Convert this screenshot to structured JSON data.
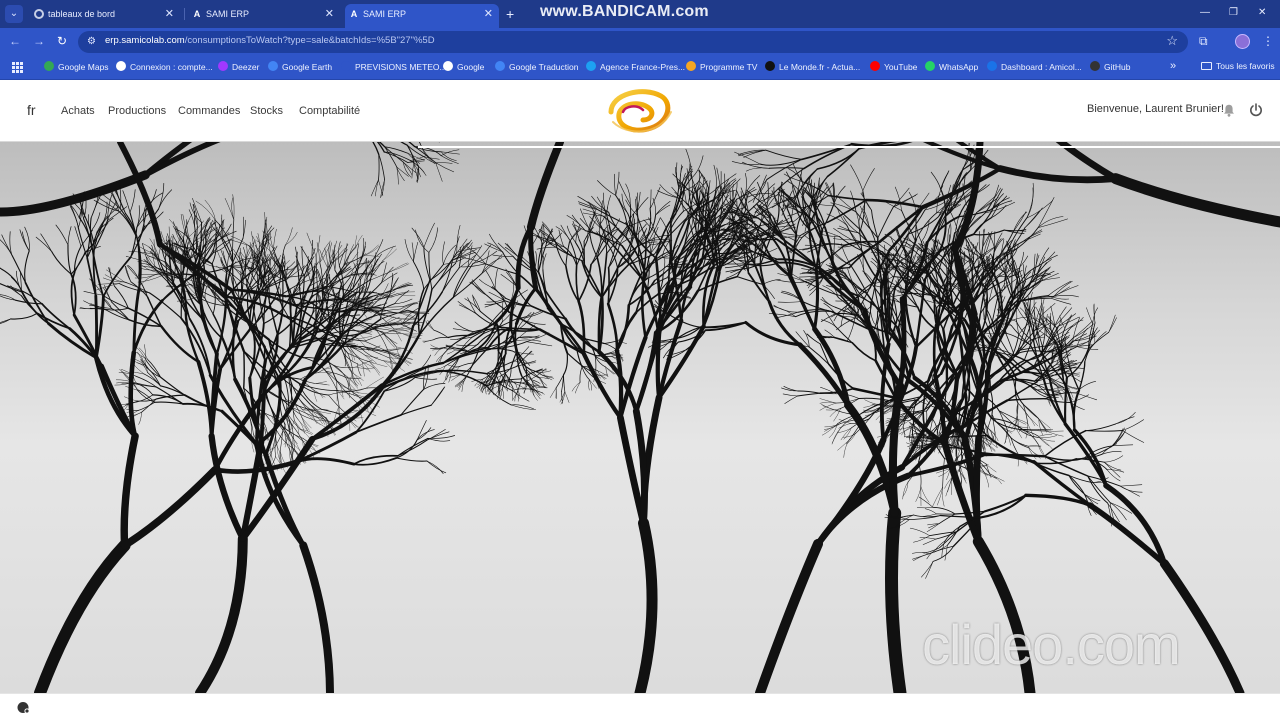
{
  "browser": {
    "tabs": [
      {
        "title": "tableaux de bord",
        "active": false,
        "favicon": "gear-icon"
      },
      {
        "title": "SAMI ERP",
        "active": false,
        "favicon": "angular-icon"
      },
      {
        "title": "SAMI ERP",
        "active": true,
        "favicon": "angular-icon"
      }
    ],
    "recorder_watermark": "www.BANDICAM.com",
    "address": {
      "host": "erp.samicolab.com",
      "path": "/consumptionsToWatch?type=sale&batchIds=%5B\"27\"%5D"
    },
    "bookmarks": [
      {
        "label": "Google Maps",
        "color": "#34a853"
      },
      {
        "label": "Connexion : compte...",
        "color": "#ffffff"
      },
      {
        "label": "Deezer",
        "color": "#a238ff"
      },
      {
        "label": "Google Earth",
        "color": "#4285f4"
      },
      {
        "label": "PREVISIONS METEO...",
        "color": "#2f55c8"
      },
      {
        "label": "Google",
        "color": "#ffffff"
      },
      {
        "label": "Google Traduction",
        "color": "#4285f4"
      },
      {
        "label": "Agence France-Pres...",
        "color": "#1da1f2"
      },
      {
        "label": "Programme TV",
        "color": "#f5a623"
      },
      {
        "label": "Le Monde.fr - Actua...",
        "color": "#111111"
      },
      {
        "label": "YouTube",
        "color": "#ff0000"
      },
      {
        "label": "WhatsApp",
        "color": "#25d366"
      },
      {
        "label": "Dashboard : Amicol...",
        "color": "#1a73e8"
      },
      {
        "label": "GitHub",
        "color": "#333333"
      }
    ],
    "all_bookmarks_label": "Tous les favoris"
  },
  "app": {
    "language": "fr",
    "menu": [
      "Achats",
      "Productions",
      "Commandes",
      "Stocks",
      "Comptabilité"
    ],
    "welcome": "Bienvenue, Laurent Brunier!",
    "accent_color": "#f0a500"
  },
  "overlay": {
    "video_watermark": "clideo.com"
  }
}
